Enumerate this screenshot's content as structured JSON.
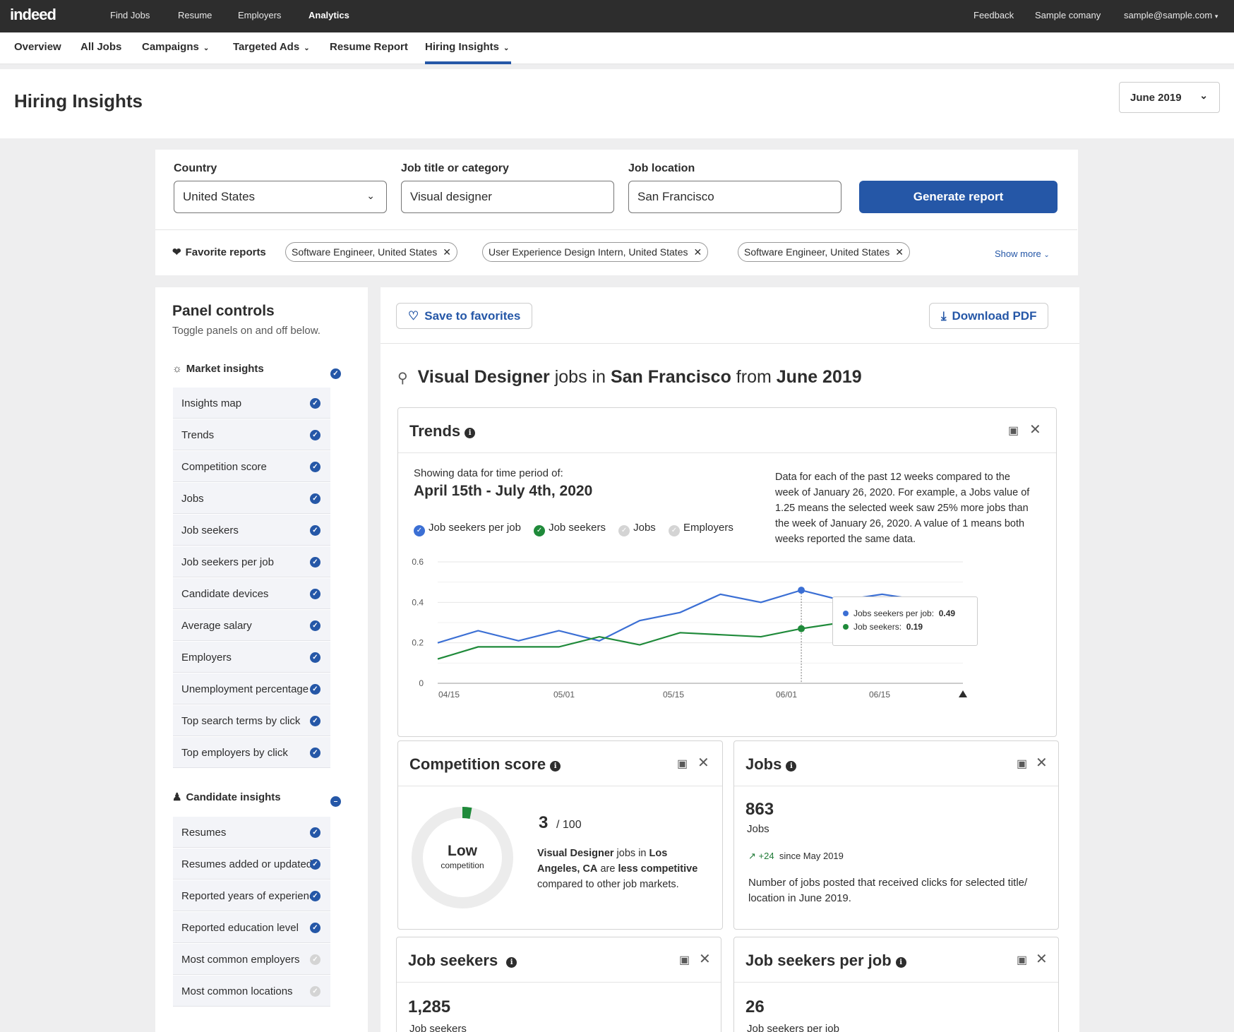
{
  "topbar": {
    "logo": "indeed",
    "nav": [
      "Find Jobs",
      "Resume",
      "Employers",
      "Analytics"
    ],
    "right": [
      "Feedback",
      "Sample comany",
      "sample@sample.com"
    ]
  },
  "subnav": {
    "tabs": [
      "Overview",
      "All Jobs",
      "Campaigns",
      "Targeted Ads",
      "Resume Report",
      "Hiring Insights"
    ]
  },
  "header": {
    "title": "Hiring Insights",
    "month": "June 2019"
  },
  "filters": {
    "country_label": "Country",
    "country_value": "United States",
    "job_label": "Job title or category",
    "job_value": "Visual designer",
    "location_label": "Job location",
    "location_value": "San Francisco",
    "generate": "Generate report"
  },
  "favorites": {
    "label": "Favorite reports",
    "chips": [
      "Software Engineer, United States",
      "User Experience Design Intern, United States",
      "Software Engineer, United States"
    ],
    "show_more": "Show more"
  },
  "side": {
    "title": "Panel controls",
    "subtitle": "Toggle panels on and off below.",
    "market_label": "Market insights",
    "market_items": [
      "Insights map",
      "Trends",
      "Competition score",
      "Jobs",
      "Job seekers",
      "Job seekers per job",
      "Candidate devices",
      "Average salary",
      "Employers",
      "Unemployment percentage",
      "Top search terms by click",
      "Top employers by click"
    ],
    "candidate_label": "Candidate insights",
    "candidate_items": [
      "Resumes",
      "Resumes added or updated",
      "Reported years of experience",
      "Reported education level",
      "Most common employers",
      "Most common locations"
    ]
  },
  "main": {
    "save": "Save to favorites",
    "download": "Download PDF",
    "query": {
      "job": "Visual Designer",
      "mid1": " jobs in ",
      "loc": "San Francisco",
      "mid2": " from ",
      "date": "June 2019"
    }
  },
  "trends": {
    "title": "Trends",
    "period_label": "Showing data for time period of:",
    "period": "April 15th - July 4th, 2020",
    "description": "Data for each of the past 12 weeks compared to the week of January 26, 2020. For example, a Jobs value of 1.25 means the selected week saw 25% more jobs than the week of January 26, 2020. A value of 1 means both weeks reported the same data.",
    "legend": [
      "Job seekers per job",
      "Job seekers",
      "Jobs",
      "Employers"
    ],
    "tooltip": {
      "l1": "Jobs seekers per job:",
      "v1": "0.49",
      "l2": "Job seekers:",
      "v2": "0.19"
    }
  },
  "competition": {
    "title": "Competition score",
    "gauge_main": "Low",
    "gauge_sub": "competition",
    "score": "3",
    "out_of": "/ 100",
    "d_job": "Visual Designer",
    "d_mid1": " jobs in ",
    "d_loc": "Los Angeles, CA",
    "d_mid2": " are ",
    "d_comp": "less competitive",
    "d_end": " compared to other job markets."
  },
  "jobs": {
    "title": "Jobs",
    "value": "863",
    "label": "Jobs",
    "change": "+24",
    "since": "since May 2019",
    "description": "Number of jobs posted that received clicks for selected title/ location in June 2019."
  },
  "job_seekers": {
    "title": "Job seekers",
    "value": "1,285",
    "label": "Job seekers"
  },
  "seekers_per_job": {
    "title": "Job seekers per job",
    "value": "26",
    "label": "Job seekers per job"
  },
  "chart_data": {
    "type": "line",
    "ylim": [
      0,
      0.6
    ],
    "yticks": [
      "0",
      "0.2",
      "0.4",
      "0.6"
    ],
    "xticks": [
      "04/15",
      "05/01",
      "05/15",
      "06/01",
      "06/15"
    ],
    "series": [
      {
        "name": "Job seekers per job",
        "color": "#3b6fd4",
        "values": [
          0.2,
          0.26,
          0.21,
          0.26,
          0.21,
          0.31,
          0.35,
          0.44,
          0.4,
          0.46,
          0.41,
          0.44,
          0.41,
          0.42
        ]
      },
      {
        "name": "Job seekers",
        "color": "#1f8a3a",
        "values": [
          0.12,
          0.18,
          0.18,
          0.18,
          0.23,
          0.19,
          0.25,
          0.24,
          0.23,
          0.27,
          0.3,
          0.24,
          0.27,
          0.34
        ]
      }
    ],
    "accent": "#2557a7"
  }
}
